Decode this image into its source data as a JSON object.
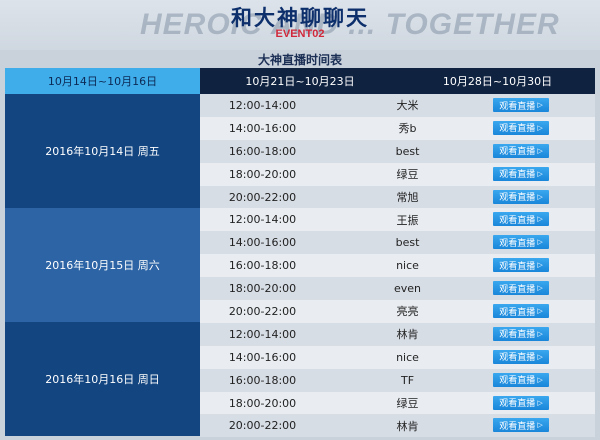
{
  "header": {
    "bg_text": "HEROIC AND ... TOGETHER",
    "title": "和大神聊聊天",
    "event": "EVENT02",
    "subtitle": "大神直播时间表"
  },
  "tabs": [
    "10月14日~10月16日",
    "10月21日~10月23日",
    "10月28日~10月30日"
  ],
  "active_tab": 0,
  "days": [
    {
      "label": "2016年10月14日 周五",
      "slots": [
        {
          "time": "12:00-14:00",
          "host": "大米",
          "button": "观看直播"
        },
        {
          "time": "14:00-16:00",
          "host": "秀b",
          "button": "观看直播"
        },
        {
          "time": "16:00-18:00",
          "host": "best",
          "button": "观看直播"
        },
        {
          "time": "18:00-20:00",
          "host": "绿豆",
          "button": "观看直播"
        },
        {
          "time": "20:00-22:00",
          "host": "常旭",
          "button": "观看直播"
        }
      ]
    },
    {
      "label": "2016年10月15日 周六",
      "slots": [
        {
          "time": "12:00-14:00",
          "host": "王振",
          "button": "观看直播"
        },
        {
          "time": "14:00-16:00",
          "host": "best",
          "button": "观看直播"
        },
        {
          "time": "16:00-18:00",
          "host": "nice",
          "button": "观看直播"
        },
        {
          "time": "18:00-20:00",
          "host": "even",
          "button": "观看直播"
        },
        {
          "time": "20:00-22:00",
          "host": "亮亮",
          "button": "观看直播"
        }
      ]
    },
    {
      "label": "2016年10月16日 周日",
      "slots": [
        {
          "time": "12:00-14:00",
          "host": "林肯",
          "button": "观看直播"
        },
        {
          "time": "14:00-16:00",
          "host": "nice",
          "button": "观看直播"
        },
        {
          "time": "16:00-18:00",
          "host": "TF",
          "button": "观看直播"
        },
        {
          "time": "18:00-20:00",
          "host": "绿豆",
          "button": "观看直播"
        },
        {
          "time": "20:00-22:00",
          "host": "林肯",
          "button": "观看直播"
        }
      ]
    }
  ],
  "colors": {
    "active_tab": "#40adeb",
    "inactive_tab": "#0f2240",
    "day_dark": "#134581",
    "day_light": "#2d64a5",
    "button": "#1a86d9",
    "title": "#0d2f6b",
    "event": "#d0283a"
  },
  "icons": {
    "watch_arrow": "play-arrow-icon"
  }
}
